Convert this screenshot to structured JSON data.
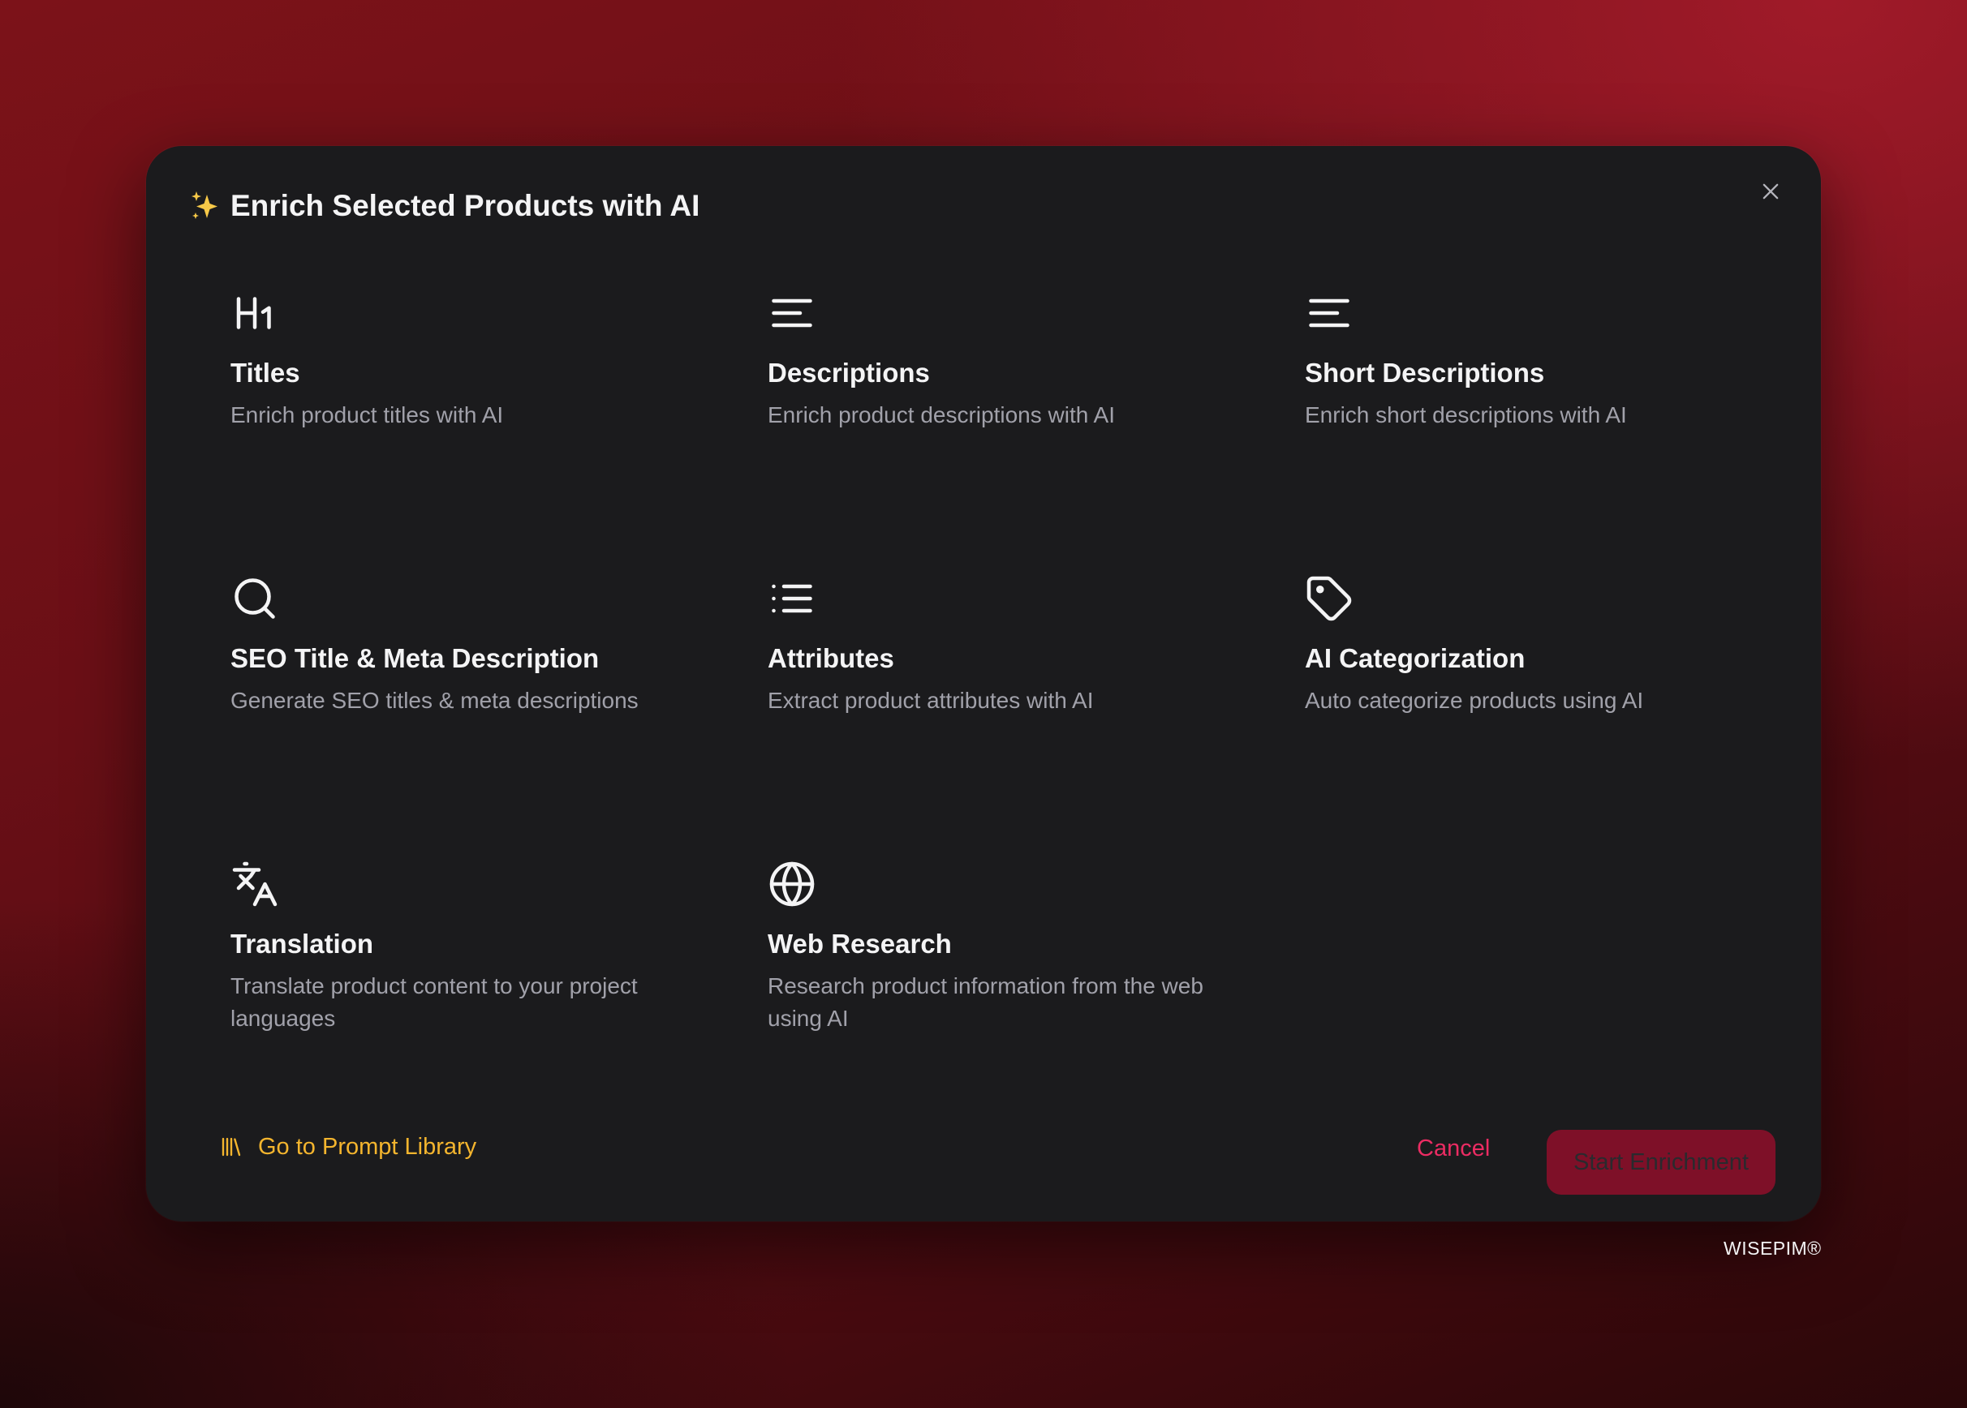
{
  "modal": {
    "title": "Enrich Selected Products with AI",
    "title_icon": "sparkles-icon",
    "close_icon": "close-icon"
  },
  "options": [
    {
      "icon": "heading-1-icon",
      "title": "Titles",
      "description": "Enrich product titles with AI"
    },
    {
      "icon": "align-left-icon",
      "title": "Descriptions",
      "description": "Enrich product descriptions with AI"
    },
    {
      "icon": "align-left-icon",
      "title": "Short Descriptions",
      "description": "Enrich short descriptions with AI"
    },
    {
      "icon": "search-icon",
      "title": "SEO Title & Meta Description",
      "description": "Generate SEO titles & meta descriptions"
    },
    {
      "icon": "list-icon",
      "title": "Attributes",
      "description": "Extract product attributes with AI"
    },
    {
      "icon": "tag-icon",
      "title": "AI Categorization",
      "description": "Auto categorize products using AI"
    },
    {
      "icon": "languages-icon",
      "title": "Translation",
      "description": "Translate product content to your project languages"
    },
    {
      "icon": "globe-icon",
      "title": "Web Research",
      "description": "Research product information from the web using AI"
    }
  ],
  "footer": {
    "prompt_library_icon": "library-icon",
    "prompt_library_label": "Go to Prompt Library",
    "cancel_label": "Cancel",
    "start_label": "Start Enrichment"
  },
  "brand": "WISEPIM®",
  "colors": {
    "accent_gold": "#f4b52e",
    "cancel_pink": "#ec2c63",
    "primary_button": "#7e1028",
    "modal_bg": "#1b1b1d"
  }
}
